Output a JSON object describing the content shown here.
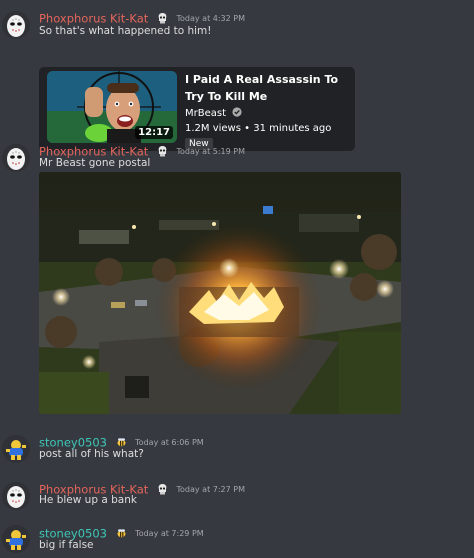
{
  "messages": [
    {
      "author": "Phoxphorus Kit-Kat",
      "timestamp": "Today at 4:32 PM",
      "text": "So that's what happened to him!",
      "embed": {
        "title": "I Paid A Real Assassin To Try To Kill Me",
        "channel": "MrBeast",
        "views": "1.2M views",
        "separator": "•",
        "age": "31 minutes ago",
        "tag": "New",
        "duration": "12:17"
      }
    },
    {
      "author": "Phoxphorus Kit-Kat",
      "timestamp": "Today at 5:19 PM",
      "text": "Mr Beast gone postal"
    },
    {
      "author": "stoney0503",
      "timestamp": "Today at 6:06 PM",
      "text": "post all of his what?"
    },
    {
      "author": "Phoxphorus Kit-Kat",
      "timestamp": "Today at 7:27 PM",
      "text": "He blew up a bank"
    },
    {
      "author": "stoney0503",
      "timestamp": "Today at 7:29 PM",
      "text": "big if false"
    }
  ],
  "colors": {
    "background": "#36393f",
    "embed_background": "#202225",
    "name_red": "#e5655c",
    "name_teal": "#3ec7b8",
    "timestamp": "#a3a6aa",
    "text": "#dcddde"
  },
  "icons": {
    "kitkat_avatar": "hockey-mask-avatar",
    "stoney_avatar": "cartoon-character-avatar",
    "kitkat_badge": "skull-badge-icon",
    "stoney_badge": "bee-badge-icon",
    "verified": "verified-check-icon"
  }
}
